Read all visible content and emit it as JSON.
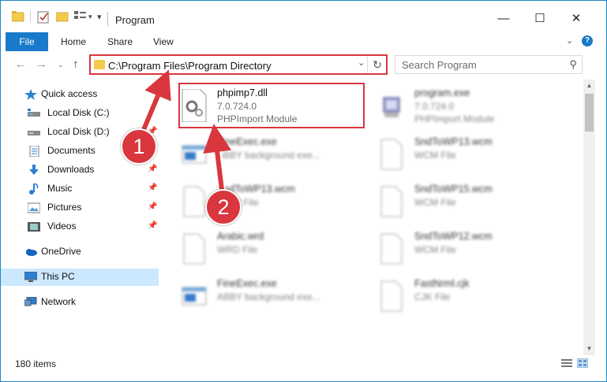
{
  "window": {
    "title": "Program",
    "controls": {
      "minimize": "—",
      "maximize": "☐",
      "close": "✕"
    }
  },
  "ribbon": {
    "tabs": [
      "File",
      "Home",
      "Share",
      "View"
    ],
    "expand_icon": "chevron-down-icon",
    "help_label": "?"
  },
  "address": {
    "path": "C:\\Program Files\\Program Directory",
    "search_placeholder": "Search Program"
  },
  "navigation": {
    "quick_access": "Quick access",
    "items": [
      {
        "label": "Local Disk (C:)",
        "icon": "drive-icon",
        "pinned": false
      },
      {
        "label": "Local Disk (D:)",
        "icon": "drive-icon",
        "pinned": true
      },
      {
        "label": "Documents",
        "icon": "documents-icon",
        "pinned": true
      },
      {
        "label": "Downloads",
        "icon": "downloads-icon",
        "pinned": true
      },
      {
        "label": "Music",
        "icon": "music-icon",
        "pinned": true
      },
      {
        "label": "Pictures",
        "icon": "pictures-icon",
        "pinned": true
      },
      {
        "label": "Videos",
        "icon": "videos-icon",
        "pinned": true
      }
    ],
    "onedrive": "OneDrive",
    "this_pc": "This PC",
    "network": "Network"
  },
  "files": [
    {
      "name": "phpimp7.dll",
      "line1": "7.0.724.0",
      "line2": "PHPImport Module",
      "icon": "dll-gear-icon",
      "highlighted": true
    },
    {
      "name": "program.exe",
      "line1": "7.0.724.0",
      "line2": "PHPImport Module",
      "icon": "exe-icon",
      "highlighted": false
    },
    {
      "name": "FineExec.exe",
      "line1": "ABBY background exe...",
      "line2": "",
      "icon": "exe-window-icon",
      "highlighted": false
    },
    {
      "name": "SndToWP13.wcm",
      "line1": "WCM File",
      "line2": "",
      "icon": "blank-file-icon",
      "highlighted": false
    },
    {
      "name": "SndToWP13.wcm",
      "line1": "WCM File",
      "line2": "",
      "icon": "blank-file-icon",
      "highlighted": false
    },
    {
      "name": "SndToWP15.wcm",
      "line1": "WCM File",
      "line2": "",
      "icon": "blank-file-icon",
      "highlighted": false
    },
    {
      "name": "Arabic.wrd",
      "line1": "WRD File",
      "line2": "",
      "icon": "blank-file-icon",
      "highlighted": false
    },
    {
      "name": "SndToWP12.wcm",
      "line1": "WCM File",
      "line2": "",
      "icon": "blank-file-icon",
      "highlighted": false
    },
    {
      "name": "FineExec.exe",
      "line1": "ABBY background exe...",
      "line2": "",
      "icon": "exe-window-icon",
      "highlighted": false
    },
    {
      "name": "FastNrml.cjk",
      "line1": "CJK File",
      "line2": "",
      "icon": "blank-file-icon",
      "highlighted": false
    }
  ],
  "status": {
    "item_count": "180 items"
  },
  "annotations": {
    "step1": "1",
    "step2": "2",
    "color": "#d9363e"
  }
}
